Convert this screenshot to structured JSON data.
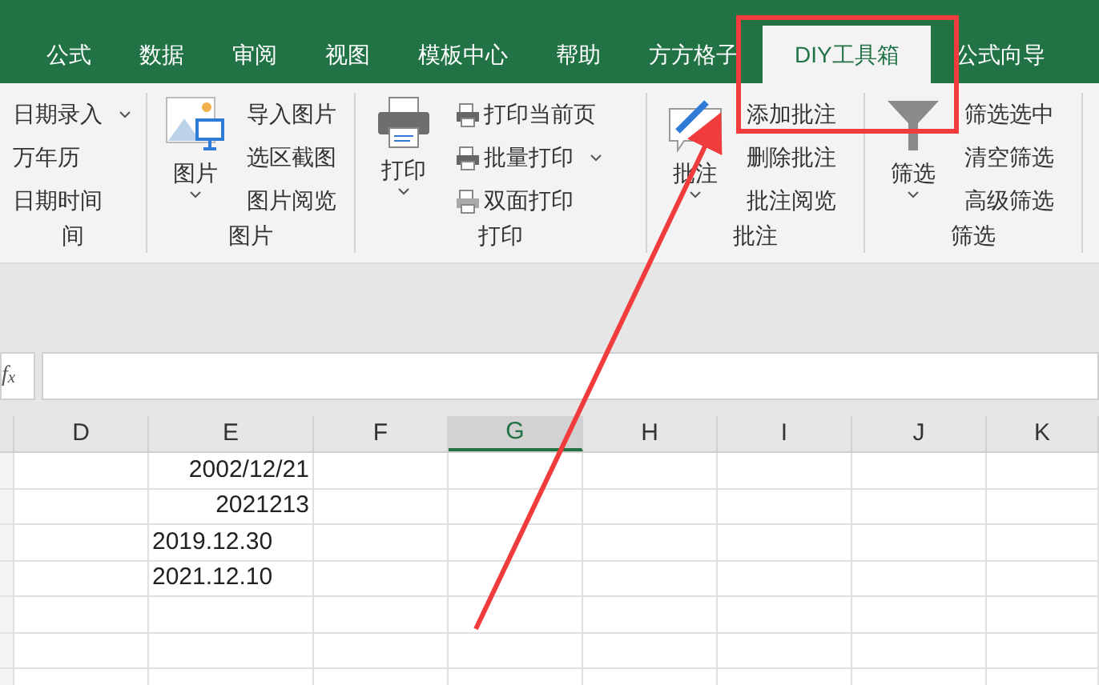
{
  "tabs": [
    {
      "label": "公式",
      "selected": false
    },
    {
      "label": "数据",
      "selected": false
    },
    {
      "label": "审阅",
      "selected": false
    },
    {
      "label": "视图",
      "selected": false
    },
    {
      "label": "模板中心",
      "selected": false
    },
    {
      "label": "帮助",
      "selected": false
    },
    {
      "label": "方方格子",
      "selected": false
    },
    {
      "label": "DIY工具箱",
      "selected": true
    },
    {
      "label": "公式向导",
      "selected": false
    }
  ],
  "ribbon_groups": [
    {
      "kind": "list",
      "label": "间",
      "items": [
        {
          "label": "日期录入",
          "caret": true
        },
        {
          "label": "万年历",
          "caret": false
        },
        {
          "label": "日期时间",
          "caret": false
        }
      ]
    },
    {
      "kind": "picture",
      "label": "图片",
      "big_button": "图片",
      "items": [
        {
          "label": "导入图片",
          "caret": false
        },
        {
          "label": "选区截图",
          "caret": false
        },
        {
          "label": "图片阅览",
          "caret": false
        }
      ]
    },
    {
      "kind": "print",
      "label": "打印",
      "big_button": "打印",
      "items": [
        {
          "label": "打印当前页",
          "caret": false
        },
        {
          "label": "批量打印",
          "caret": true
        },
        {
          "label": "双面打印",
          "caret": false
        }
      ]
    },
    {
      "kind": "comment",
      "label": "批注",
      "big_button": "批注",
      "items": [
        {
          "label": "添加批注",
          "caret": false
        },
        {
          "label": "删除批注",
          "caret": false
        },
        {
          "label": "批注阅览",
          "caret": false
        }
      ]
    },
    {
      "kind": "filter",
      "label": "筛选",
      "big_button": "筛选",
      "items": [
        {
          "label": "筛选选中",
          "caret": false
        },
        {
          "label": "清空筛选",
          "caret": false
        },
        {
          "label": "高级筛选",
          "caret": false
        }
      ]
    }
  ],
  "formula_bar": {
    "label": "f$_{x}$"
  },
  "columns": [
    {
      "label": "D",
      "selected": false
    },
    {
      "label": "E",
      "selected": false
    },
    {
      "label": "F",
      "selected": false
    },
    {
      "label": "G",
      "selected": true
    },
    {
      "label": "H",
      "selected": false
    },
    {
      "label": "I",
      "selected": false
    },
    {
      "label": "J",
      "selected": false
    },
    {
      "label": "K",
      "selected": false
    }
  ],
  "rows": [
    {
      "E": "2002/12/21",
      "kind": "number"
    },
    {
      "E": "2021213",
      "kind": "number"
    },
    {
      "E": "2019.12.30",
      "kind": "text"
    },
    {
      "E": "2021.12.10",
      "kind": "text"
    },
    {},
    {},
    {}
  ]
}
